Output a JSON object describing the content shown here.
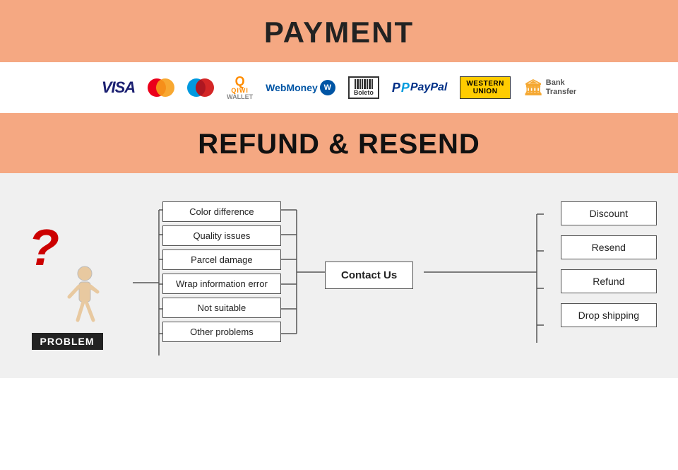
{
  "payment": {
    "title": "PAYMENT",
    "logos": [
      {
        "name": "visa",
        "label": "VISA"
      },
      {
        "name": "mastercard",
        "label": "MasterCard"
      },
      {
        "name": "maestro",
        "label": "Maestro"
      },
      {
        "name": "qiwi",
        "label": "QIWI WALLET"
      },
      {
        "name": "webmoney",
        "label": "WebMoney"
      },
      {
        "name": "boleto",
        "label": "Boleto"
      },
      {
        "name": "paypal",
        "label": "PayPal"
      },
      {
        "name": "western-union",
        "label": "WESTERN UNION"
      },
      {
        "name": "bank-transfer",
        "label": "Bank Transfer"
      }
    ]
  },
  "refund": {
    "title": "REFUND & RESEND"
  },
  "diagram": {
    "problem_label": "PROBLEM",
    "problems": [
      {
        "label": "Color difference"
      },
      {
        "label": "Quality issues"
      },
      {
        "label": "Parcel damage"
      },
      {
        "label": "Wrap information error"
      },
      {
        "label": "Not suitable"
      },
      {
        "label": "Other problems"
      }
    ],
    "contact_label": "Contact Us",
    "solutions": [
      {
        "label": "Discount"
      },
      {
        "label": "Resend"
      },
      {
        "label": "Refund"
      },
      {
        "label": "Drop shipping"
      }
    ]
  }
}
